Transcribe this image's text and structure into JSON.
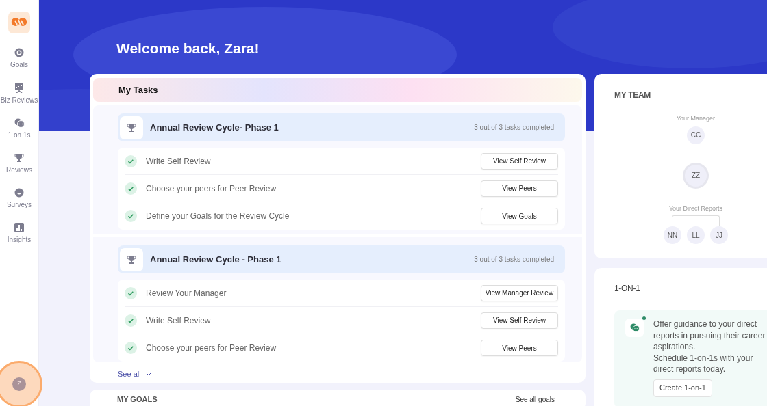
{
  "sidebar": {
    "items": [
      {
        "label": "Goals",
        "kind": "target"
      },
      {
        "label": "Biz Reviews",
        "kind": "presentation"
      },
      {
        "label": "1 on 1s",
        "kind": "chat"
      },
      {
        "label": "Reviews",
        "kind": "trophy"
      },
      {
        "label": "Surveys",
        "kind": "survey"
      },
      {
        "label": "Insights",
        "kind": "chart"
      }
    ],
    "avatar": "Z"
  },
  "welcome": "Welcome back, Zara!",
  "tasks": {
    "title": "My Tasks",
    "groups": [
      {
        "title": "Annual Review Cycle- Phase 1",
        "progress": "3 out of 3 tasks completed",
        "items": [
          {
            "label": "Write Self Review",
            "done": true,
            "button": "View Self Review"
          },
          {
            "label": "Choose your peers for Peer Review",
            "done": true,
            "button": "View Peers"
          },
          {
            "label": "Define your Goals for the Review Cycle",
            "done": true,
            "button": "View Goals"
          }
        ]
      },
      {
        "title": "Annual Review Cycle - Phase 1",
        "progress": "3 out of 3 tasks completed",
        "items": [
          {
            "label": "Review Your Manager",
            "done": true,
            "button": "View Manager Review"
          },
          {
            "label": "Write Self Review",
            "done": true,
            "button": "View Self Review"
          },
          {
            "label": "Choose your peers for Peer Review",
            "done": true,
            "button": "View Peers"
          }
        ]
      }
    ],
    "see_all": "See all"
  },
  "team": {
    "title": "MY TEAM",
    "manager_label": "Your Manager",
    "manager": "CC",
    "self": "ZZ",
    "reports_label": "Your Direct Reports",
    "reports": [
      "NN",
      "LL",
      "JJ"
    ]
  },
  "one_on_one": {
    "title": "1-ON-1",
    "message": [
      "Offer guidance to your direct reports in pursuing their career aspirations.",
      "Schedule 1-on-1s with your direct reports today."
    ],
    "button": "Create 1-on-1"
  },
  "goals": {
    "title": "MY GOALS",
    "link": "See all goals"
  }
}
